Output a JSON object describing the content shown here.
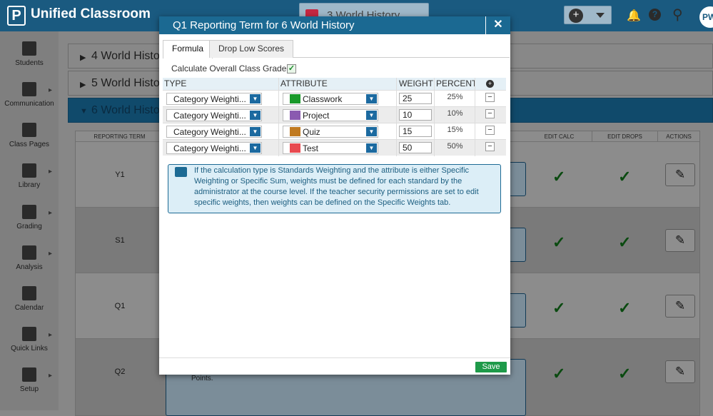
{
  "app": {
    "title": "Unified Classroom",
    "logo_letter": "P",
    "avatar_initials": "PW"
  },
  "header": {
    "class_selector": "3 World History"
  },
  "sidebar": {
    "items": [
      {
        "label": "Students",
        "icon": "students-icon"
      },
      {
        "label": "Communication",
        "icon": "communication-icon"
      },
      {
        "label": "Class Pages",
        "icon": "class-pages-icon"
      },
      {
        "label": "Library",
        "icon": "library-icon"
      },
      {
        "label": "Grading",
        "icon": "grading-icon"
      },
      {
        "label": "Analysis",
        "icon": "analysis-icon"
      },
      {
        "label": "Calendar",
        "icon": "calendar-icon"
      },
      {
        "label": "Quick Links",
        "icon": "rocket-icon"
      },
      {
        "label": "Setup",
        "icon": "gear-icon"
      }
    ]
  },
  "accordion": [
    {
      "label": "4 World Histo"
    },
    {
      "label": "5 World Histo"
    },
    {
      "label": "6 World Histo"
    }
  ],
  "grid": {
    "headers": {
      "reporting_term": "REPORTING TERM",
      "edit_calc": "EDIT CALC",
      "edit_drops": "EDIT DROPS",
      "actions": "ACTIONS"
    },
    "rows": [
      {
        "term": "Y1"
      },
      {
        "term": "S1"
      },
      {
        "term": "Q1"
      },
      {
        "term": "Q2"
      }
    ],
    "footer_text": "Points."
  },
  "modal": {
    "title": "Q1 Reporting Term for 6 World History",
    "tabs": [
      "Formula",
      "Drop Low Scores"
    ],
    "calc_overall_label": "Calculate Overall Class Grade",
    "table": {
      "headers": {
        "type": "TYPE",
        "attribute": "ATTRIBUTE",
        "weight": "WEIGHT",
        "percent": "PERCENT"
      },
      "rows": [
        {
          "type": "Category Weighti...",
          "attribute": "Classwork",
          "color": "#1a9a2a",
          "weight": "25",
          "percent": "25%"
        },
        {
          "type": "Category Weighti...",
          "attribute": "Project",
          "color": "#8a5ab0",
          "weight": "10",
          "percent": "10%"
        },
        {
          "type": "Category Weighti...",
          "attribute": "Quiz",
          "color": "#c07a20",
          "weight": "15",
          "percent": "15%"
        },
        {
          "type": "Category Weighti...",
          "attribute": "Test",
          "color": "#e84a50",
          "weight": "50",
          "percent": "50%"
        }
      ]
    },
    "info_text": "If the calculation type is Standards Weighting and the attribute is either Specific Weighting or Specific Sum, weights must be defined for each standard by the administrator at the course level. If the teacher security permissions are set to edit specific weights, then weights can be defined on the Specific Weights tab.",
    "save_label": "Save"
  }
}
